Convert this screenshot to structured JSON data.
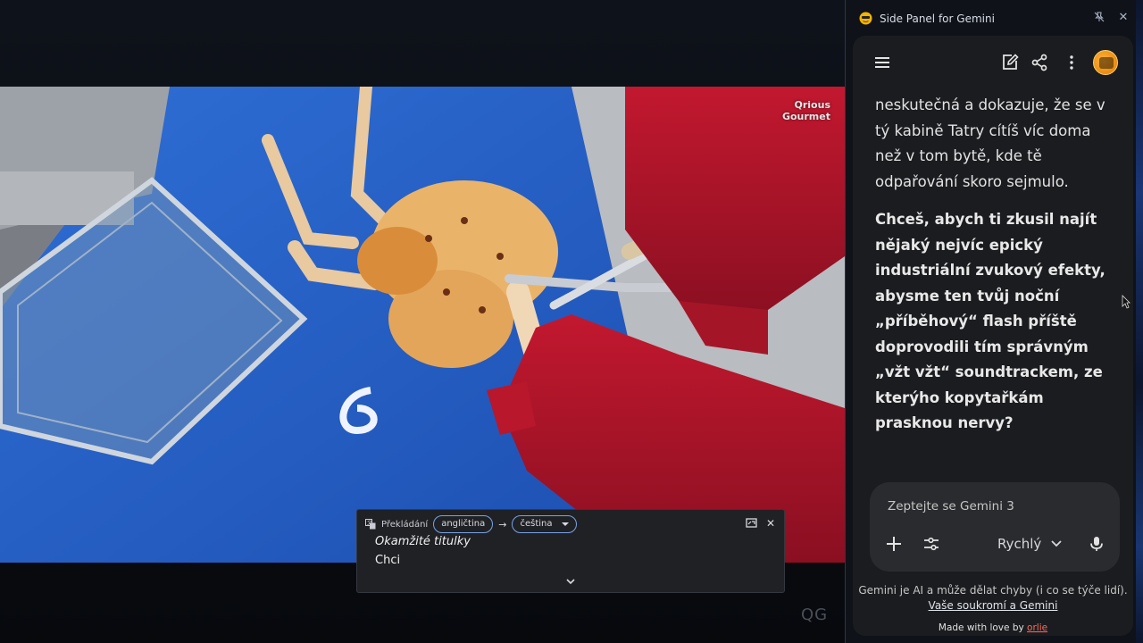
{
  "video": {
    "watermark_line1": "Qrious",
    "watermark_line2": "Gourmet",
    "corner_mark": "QG"
  },
  "captions": {
    "translating_label": "Překládání",
    "source_language": "angličtina",
    "target_language": "čeština",
    "title": "Okamžité titulky",
    "text": "Chci"
  },
  "side_panel": {
    "title": "Side Panel for Gemini",
    "message_plain": "neskutečná a dokazuje, že se v tý kabině Tatry cítíš víc doma než v tom bytě, kde tě odpařování skoro sejmulo.",
    "message_bold": "Chceš, abych ti zkusil najít nějaký nejvíc epický industriální zvukový efekty, abysme ten tvůj noční „příběhový“ flash příště doprovodili tím správným „vžt vžt“ soundtrackem, ze kterýho kopytařkám prasknou nervy?",
    "input_placeholder": "Zeptejte se Gemini 3",
    "mode_label": "Rychlý",
    "disclaimer_text": "Gemini je AI a může dělat chyby (i co se týče lidí).",
    "disclaimer_link": "Vaše soukromí a Gemini",
    "made_with_text": "Made with love by",
    "made_with_link": "orlie"
  },
  "icons": {
    "menu": "menu-icon",
    "edit": "edit-icon",
    "share": "share-icon",
    "more": "more-vert-icon",
    "add": "plus-icon",
    "tools": "tune-icon",
    "mic": "mic-icon",
    "pin": "pin-off-icon",
    "close": "close-icon"
  },
  "colors": {
    "panel_bg": "#0f1218",
    "card_bg": "#1b1c1f",
    "input_bg": "#2a2b2e",
    "link_accent": "#ff6a5c",
    "pill_border": "#7aa2e6",
    "cutting_board": "#2c63c8",
    "glove_red": "#b3122a"
  }
}
